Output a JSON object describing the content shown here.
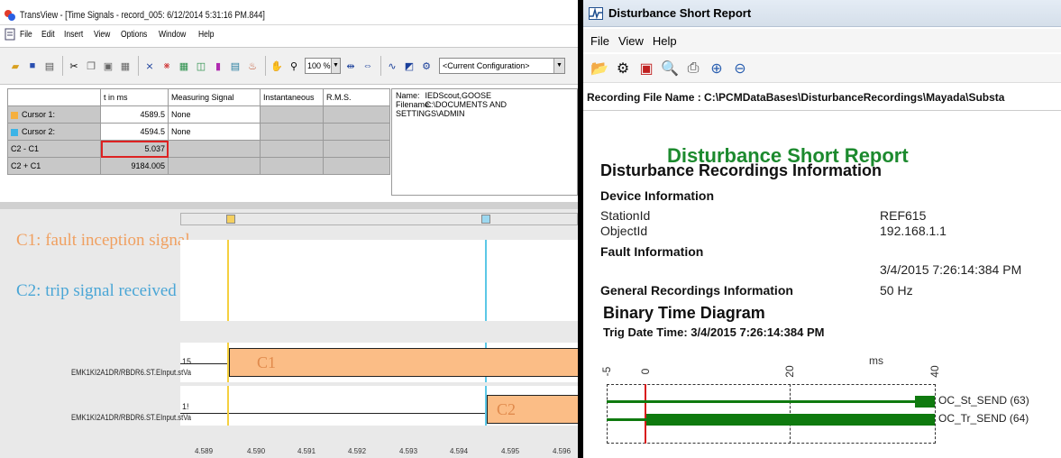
{
  "transview": {
    "title": "TransView - [Time Signals - record_005: 6/12/2014 5:31:16 PM.844]",
    "menu": [
      "File",
      "Edit",
      "Insert",
      "View",
      "Options",
      "Window",
      "Help"
    ],
    "toolbar": {
      "zoom": "100 %",
      "configuration": "<Current Configuration>"
    },
    "table": {
      "headers": [
        "",
        "t in ms",
        "Measuring Signal",
        "Instantaneous",
        "R.M.S."
      ],
      "rows": [
        {
          "name": "Cursor 1:",
          "t": "4589.5",
          "signal": "None",
          "color": "#f5b040"
        },
        {
          "name": "Cursor 2:",
          "t": "4594.5",
          "signal": "None",
          "color": "#3cb4e6"
        },
        {
          "name": "C2 - C1",
          "t": "5.037",
          "signal": ""
        },
        {
          "name": "C2 + C1",
          "t": "9184.005",
          "signal": ""
        }
      ]
    },
    "info": {
      "name_label": "Name:",
      "name_value": "IEDScout,GOOSE",
      "filename_label": "Filename:",
      "filename_value": "C:\\DOCUMENTS AND SETTINGS\\ADMIN"
    },
    "legend": {
      "c1": "C1: fault inception signal",
      "c2": "C2: trip signal received"
    },
    "signals": [
      {
        "label": "EMK1KI2A1DR/RBDR6.ST.EInput.stVa",
        "value": "15",
        "bar_text": "C1"
      },
      {
        "label": "EMK1KI2A1DR/RBDR6.ST.EInput.stVa",
        "value": "1!",
        "bar_text": "C2"
      }
    ],
    "x_ticks": [
      "4.589",
      "4.590",
      "4.591",
      "4.592",
      "4.593",
      "4.594",
      "4.595",
      "4.596"
    ],
    "colors": {
      "cursor1": "#f5d040",
      "cursor2": "#5cc8e6",
      "bar": "#fbbd86"
    }
  },
  "report": {
    "window_title": "Disturbance Short Report",
    "menu": [
      "File",
      "View",
      "Help"
    ],
    "recording_file": "Recording File Name : C:\\PCMDataBases\\DisturbanceRecordings\\Mayada\\Substa",
    "title": "Disturbance Short Report",
    "section_title": "Disturbance Recordings Information",
    "device_info": "Device Information",
    "station_label": "StationId",
    "station_value": "REF615",
    "object_label": "ObjectId",
    "object_value": "192.168.1.1",
    "fault_info": "Fault Information",
    "fault_time": "3/4/2015 7:26:14:384 PM",
    "general_label": "General Recordings Information",
    "general_value": "50 Hz",
    "binary_title": "Binary Time Diagram",
    "trig_time": "Trig Date Time: 3/4/2015 7:26:14:384 PM",
    "unit": "ms",
    "ticks": [
      "-5",
      "0",
      "20",
      "40"
    ],
    "channels": [
      "OC_St_SEND (63)",
      "OC_Tr_SEND (64)"
    ],
    "colors": {
      "title": "#1c8a2e",
      "trace": "#0f7a0f",
      "trigger": "#d81b1b"
    }
  }
}
